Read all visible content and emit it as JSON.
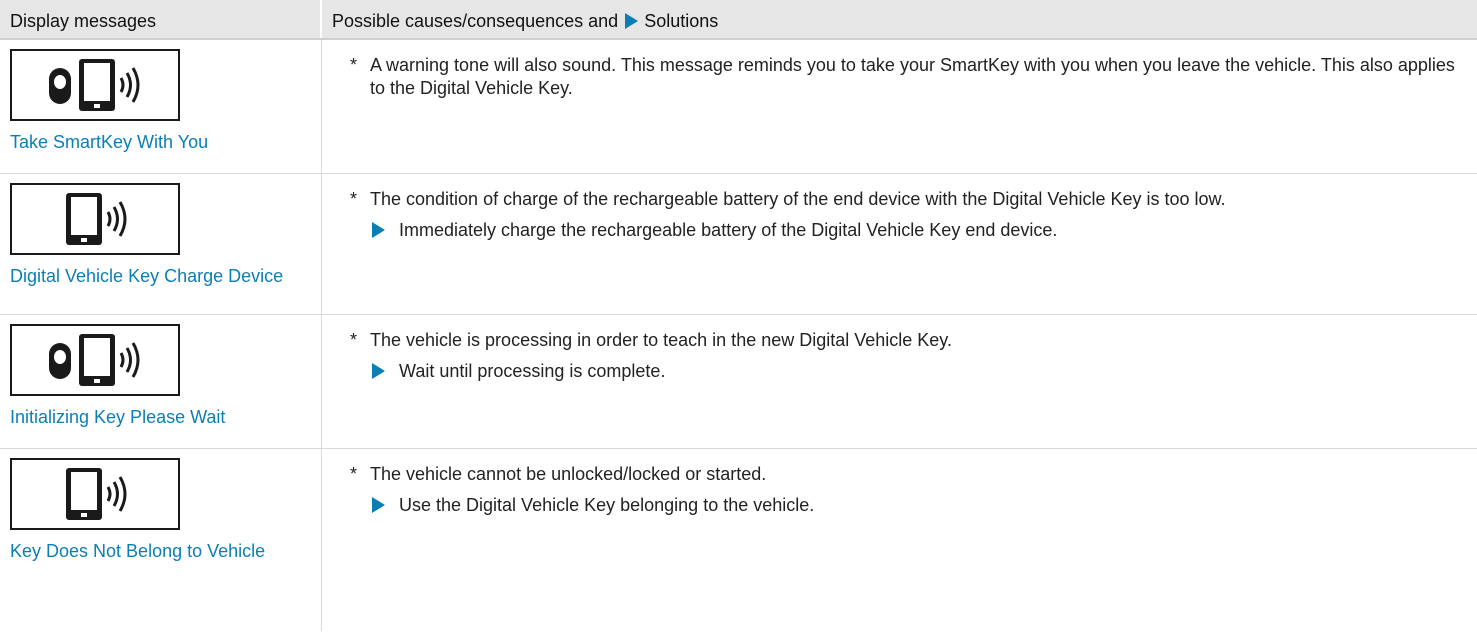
{
  "header": {
    "left_label": "Display messages",
    "right_label_prefix": "Possible causes/consequences and",
    "right_label_suffix": "Solutions"
  },
  "rows": [
    {
      "icon": "key-fob-and-phone-icon",
      "message": "Take SmartKey With You",
      "cause": "A warning tone will also sound. This message reminds you to take your SmartKey with you when you leave the vehicle. This also applies to the Digital Vehicle Key.",
      "solution": ""
    },
    {
      "icon": "phone-signal-icon",
      "message": "Digital Vehicle Key Charge Device",
      "cause": "The condition of charge of the rechargeable battery of the end device with the Digital Vehicle Key is too low.",
      "solution": "Immediately charge the rechargeable battery of the Digital Vehicle Key end device."
    },
    {
      "icon": "key-fob-and-phone-icon",
      "message": "Initializing Key Please Wait",
      "cause": "The vehicle is processing in order to teach in the new Digital Vehicle Key.",
      "solution": "Wait until processing is complete."
    },
    {
      "icon": "phone-signal-icon",
      "message": "Key Does Not Belong to Vehicle",
      "cause": "The vehicle cannot be unlocked/locked or started.",
      "solution": "Use the Digital Vehicle Key belonging to the vehicle."
    }
  ],
  "bullet_symbol": "*",
  "colors": {
    "accent": "#0b7fb3",
    "header_bg": "#e6e6e6",
    "divider": "#d9d9d9"
  }
}
